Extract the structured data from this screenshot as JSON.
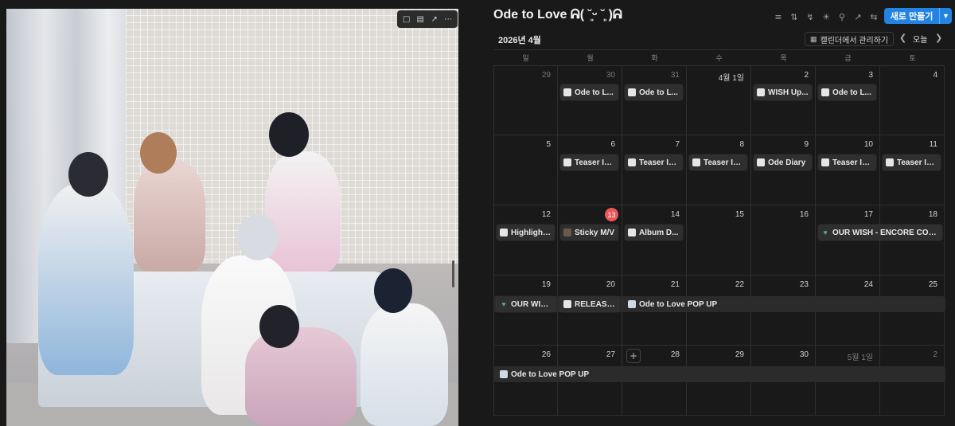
{
  "image_toolbar": {
    "icons": [
      "comment-icon",
      "caption-icon",
      "open-original-icon",
      "more-icon"
    ]
  },
  "calendar": {
    "title": "Ode to Love ᕱ( ˘͈ᵕ ˘͈ )ᕱ",
    "toolbar_icons": [
      "filter-icon",
      "sort-icon",
      "automation-icon",
      "sun-icon",
      "search-icon",
      "expand-icon",
      "settings-icon"
    ],
    "new_button": "새로 만들기",
    "month_label": "2026년 4월",
    "manage_button": "캘린더에서 관리하기",
    "today_button": "오늘",
    "weekdays": [
      "일",
      "월",
      "화",
      "수",
      "목",
      "금",
      "토"
    ],
    "weeks": [
      [
        "29",
        "30",
        "31",
        "4월 1일",
        "2",
        "3",
        "4"
      ],
      [
        "5",
        "6",
        "7",
        "8",
        "9",
        "10",
        "11"
      ],
      [
        "12",
        "13",
        "14",
        "15",
        "16",
        "17",
        "18"
      ],
      [
        "19",
        "20",
        "21",
        "22",
        "23",
        "24",
        "25"
      ],
      [
        "26",
        "27",
        "28",
        "29",
        "30",
        "5월 1일",
        "2"
      ]
    ],
    "events": {
      "w0_mon": "Ode to L...",
      "w0_tue": "Ode to L...",
      "w0_thu": "WISH Up...",
      "w0_fri": "Ode to L...",
      "w1_mon": "Teaser Im...",
      "w1_tue": "Teaser Im...",
      "w1_wed": "Teaser Im...",
      "w1_thu": "Ode Diary",
      "w1_fri": "Teaser Im...",
      "w1_sat": "Teaser Im...",
      "w2_sun": "Highlight...",
      "w2_mon": "Sticky M/V",
      "w2_tue": "Album D...",
      "w2_fri": "OUR WISH - ENCORE CON...",
      "w3_sun": "OUR WIS...",
      "w3_mon": "RELEASE !",
      "w3_tue_span": "Ode to Love POP UP",
      "w4_sun_span": "Ode to Love POP UP"
    }
  }
}
